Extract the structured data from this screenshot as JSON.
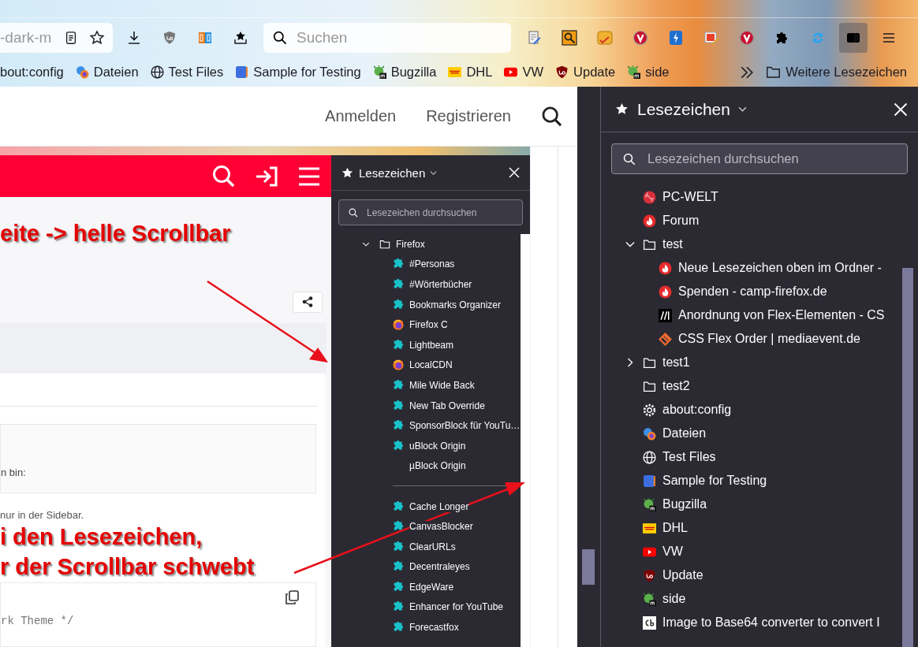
{
  "toolbar": {
    "url_fragment": "-dark-m",
    "search_placeholder": "Suchen",
    "sidebar_toggle": {
      "pressed": true
    }
  },
  "bookmarks_bar": {
    "items": [
      {
        "label": "bout:config"
      },
      {
        "label": "Dateien",
        "kind": "dateien"
      },
      {
        "label": "Test Files",
        "kind": "globe"
      },
      {
        "label": "Sample for Testing",
        "kind": "sample"
      },
      {
        "label": "Bugzilla",
        "kind": "bugzilla"
      },
      {
        "label": "DHL",
        "kind": "dhl"
      },
      {
        "label": "VW",
        "kind": "youtube"
      },
      {
        "label": "Update",
        "kind": "ublock"
      },
      {
        "label": "side",
        "kind": "bugzilla"
      }
    ],
    "more_folder": "Weitere Lesezeichen"
  },
  "site_header": {
    "links": [
      "Anmelden",
      "Registrieren"
    ]
  },
  "embedded_screenshot": {
    "heading_annotation": "eite -> helle Scrollbar",
    "post_line": "n bin:",
    "post_note": "nur in der Sidebar.",
    "annotation_lines": [
      "i den Lesezeichen,",
      "r der Scrollbar schwebt"
    ],
    "code_line": "rk Theme */",
    "sidebar": {
      "title": "Lesezeichen",
      "search_placeholder": "Lesezeichen durchsuchen",
      "tree": [
        {
          "label": "Firefox",
          "kind": "folder",
          "expanded": true,
          "children": [
            {
              "label": "#Personas",
              "kind": "puzzle"
            },
            {
              "label": "#Wörterbücher",
              "kind": "puzzle"
            },
            {
              "label": "Bookmarks Organizer",
              "kind": "puzzle"
            },
            {
              "label": "Firefox C",
              "kind": "firefox"
            },
            {
              "label": "Lightbeam",
              "kind": "puzzle"
            },
            {
              "label": "LocalCDN",
              "kind": "firefox"
            },
            {
              "label": "Mile Wide Back",
              "kind": "puzzle"
            },
            {
              "label": "New Tab Override",
              "kind": "puzzle"
            },
            {
              "label": "SponsorBlock für YouTu…",
              "kind": "puzzle"
            },
            {
              "label": "uBlock Origin",
              "kind": "puzzle"
            },
            {
              "label": "µBlock Origin",
              "kind": "blank"
            },
            {
              "kind": "separator"
            },
            {
              "label": "Cache Longer",
              "kind": "puzzle"
            },
            {
              "label": "CanvasBlocker",
              "kind": "puzzle"
            },
            {
              "label": "ClearURLs",
              "kind": "puzzle"
            },
            {
              "label": "Decentraleyes",
              "kind": "puzzle"
            },
            {
              "label": "EdgeWare",
              "kind": "puzzle"
            },
            {
              "label": "Enhancer for YouTube",
              "kind": "puzzle"
            },
            {
              "label": "Forecastfox",
              "kind": "puzzle"
            }
          ]
        }
      ]
    }
  },
  "sidebar": {
    "title": "Lesezeichen",
    "search_placeholder": "Lesezeichen durchsuchen",
    "tree": [
      {
        "label": "PC-WELT",
        "kind": "pcwelt"
      },
      {
        "label": "Forum",
        "kind": "flame"
      },
      {
        "label": "test",
        "kind": "folder",
        "expanded": true,
        "children": [
          {
            "label": "Neue Lesezeichen oben im Ordner -",
            "kind": "flame"
          },
          {
            "label": "Spenden - camp-firefox.de",
            "kind": "flame"
          },
          {
            "label": "Anordnung von Flex-Elementen - CS",
            "kind": "mdn"
          },
          {
            "label": "CSS Flex Order | mediaevent.de",
            "kind": "mediaevent"
          }
        ]
      },
      {
        "label": "test1",
        "kind": "folder",
        "expanded": false
      },
      {
        "label": "test2",
        "kind": "folder"
      },
      {
        "label": "about:config",
        "kind": "gear"
      },
      {
        "label": "Dateien",
        "kind": "dateien"
      },
      {
        "label": "Test Files",
        "kind": "globe"
      },
      {
        "label": "Sample for Testing",
        "kind": "sample"
      },
      {
        "label": "Bugzilla",
        "kind": "bugzilla"
      },
      {
        "label": "DHL",
        "kind": "dhl"
      },
      {
        "label": "VW",
        "kind": "youtube"
      },
      {
        "label": "Update",
        "kind": "ublock"
      },
      {
        "label": "side",
        "kind": "bugzilla"
      },
      {
        "label": "Image to Base64 converter to convert I",
        "kind": "cb"
      }
    ]
  }
}
